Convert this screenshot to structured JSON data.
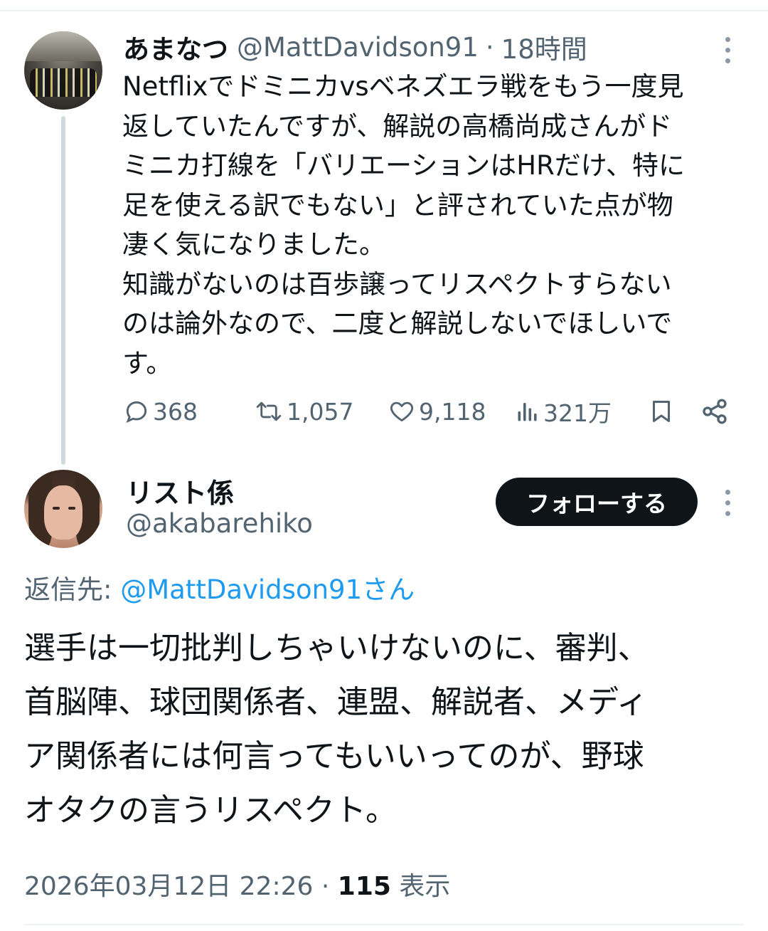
{
  "parent_tweet": {
    "display_name": "あまなつ",
    "handle": "@MattDavidson91",
    "separator": "·",
    "time_ago": "18時間",
    "text": "Netflixでドミニカvsベネズエラ戦をもう一度見\n返していたんですが、解説の高橋尚成さんがド\nミニカ打線を「バリエーションはHRだけ、特に\n足を使える訳でもない」と評されていた点が物\n凄く気になりました。\n知識がないのは百歩譲ってリスペクトすらない\nのは論外なので、二度と解説しないでほしいで\nす。",
    "replies": "368",
    "retweets": "1,057",
    "likes": "9,118",
    "views": "321万",
    "avatar_icon": "profile-photo"
  },
  "reply_tweet": {
    "display_name": "リスト係",
    "handle": "@akabarehiko",
    "follow_label": "フォローする",
    "replying_to_label": "返信先:",
    "replying_to_mention": "@MattDavidson91さん",
    "text": "選手は一切批判しちゃいけないのに、審判、\n首脳陣、球団関係者、連盟、解説者、メディ\nア関係者には何言ってもいいってのが、野球\nオタクの言うリスペクト。",
    "timestamp": "2026年03月12日 22:26",
    "separator": "·",
    "view_count": "115",
    "views_label": "表示",
    "avatar_icon": "profile-photo"
  },
  "colors": {
    "text": "#0f1419",
    "muted": "#536471",
    "link": "#1d9bf0",
    "button_bg": "#0f1419",
    "divider": "#eff3f4",
    "thread_line": "#cfd9de"
  }
}
